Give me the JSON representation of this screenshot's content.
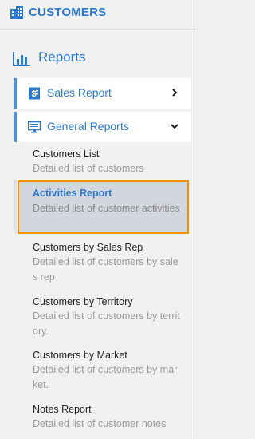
{
  "header": {
    "title": "CUSTOMERS",
    "icon": "building-icon"
  },
  "section": {
    "title": "Reports",
    "icon": "bar-chart-icon"
  },
  "nav": {
    "sales_report": {
      "label": "Sales Report",
      "icon": "invoice-dollar-icon",
      "chevron": "chevron-right-icon"
    },
    "general_reports": {
      "label": "General Reports",
      "icon": "monitor-icon",
      "chevron": "chevron-down-icon"
    }
  },
  "reports": [
    {
      "title": "Customers List",
      "desc": "Detailed list of customers"
    },
    {
      "title": "Activities Report",
      "desc": "Detailed list of customer activities",
      "active": true
    },
    {
      "title": "Customers by Sales Rep",
      "desc": "Detailed list of customers by sales rep"
    },
    {
      "title": "Customers by Territory",
      "desc": "Detailed list of customers by territory."
    },
    {
      "title": "Customers by Market",
      "desc": "Detailed list of customers by market."
    },
    {
      "title": "Notes Report",
      "desc": "Detailed list of customer notes"
    }
  ],
  "colors": {
    "accent": "#2a79d1",
    "highlight_border": "#f29100",
    "nav_bar": "#4a8fe0"
  }
}
